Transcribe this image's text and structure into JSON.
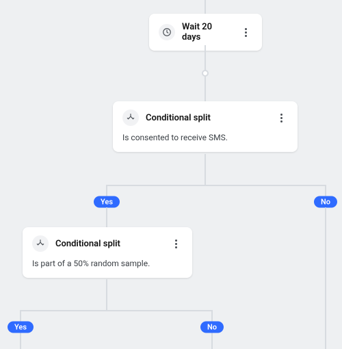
{
  "nodes": {
    "wait": {
      "title": "Wait 20 days"
    },
    "split1": {
      "title": "Conditional split",
      "desc": "Is consented to receive SMS."
    },
    "split2": {
      "title": "Conditional split",
      "desc": "Is part of a 50% random sample."
    }
  },
  "branches": {
    "split1_yes": "Yes",
    "split1_no": "No",
    "split2_yes": "Yes",
    "split2_no": "No"
  },
  "colors": {
    "badge": "#2f6bff"
  }
}
